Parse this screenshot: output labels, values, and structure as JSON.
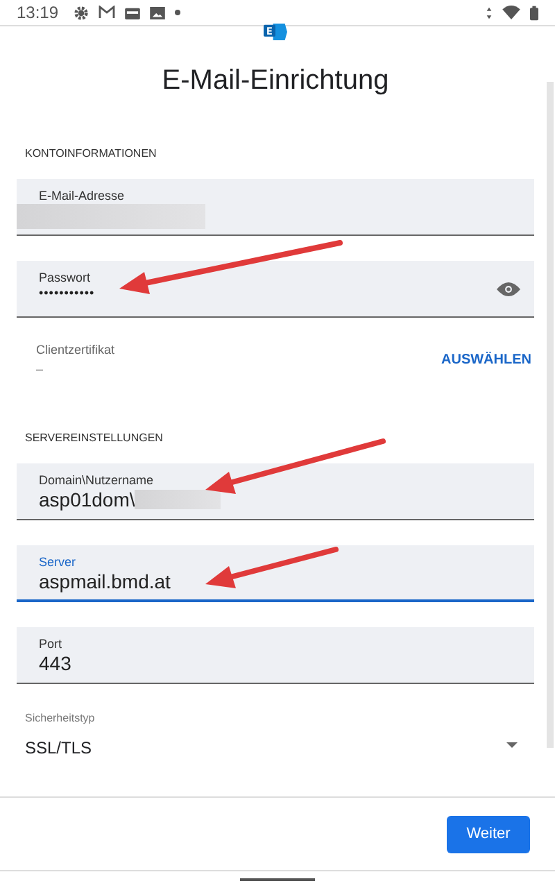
{
  "status_bar": {
    "time": "13:19"
  },
  "title": "E-Mail-Einrichtung",
  "sections": [
    {
      "heading": "KONTOINFORMATIONEN",
      "fields": [
        {
          "kind": "text",
          "label": "E-Mail-Adresse",
          "redacted": true,
          "focused": false
        },
        {
          "kind": "password",
          "label": "Passwort",
          "value": "•••••••••••",
          "focused": false
        },
        {
          "kind": "certificate",
          "label": "Clientzertifikat",
          "value": "–",
          "action": "AUSWÄHLEN"
        }
      ]
    },
    {
      "heading": "SERVEREINSTELLUNGEN",
      "fields": [
        {
          "kind": "text",
          "label": "Domain\\Nutzername",
          "value": "asp01dom\\",
          "redacted": true,
          "focused": false
        },
        {
          "kind": "text",
          "label": "Server",
          "value": "aspmail.bmd.at",
          "focused": true
        },
        {
          "kind": "text",
          "label": "Port",
          "value": "443",
          "focused": false
        },
        {
          "kind": "select",
          "label": "Sicherheitstyp",
          "value": "SSL/TLS"
        }
      ]
    }
  ],
  "next_button": "Weiter"
}
